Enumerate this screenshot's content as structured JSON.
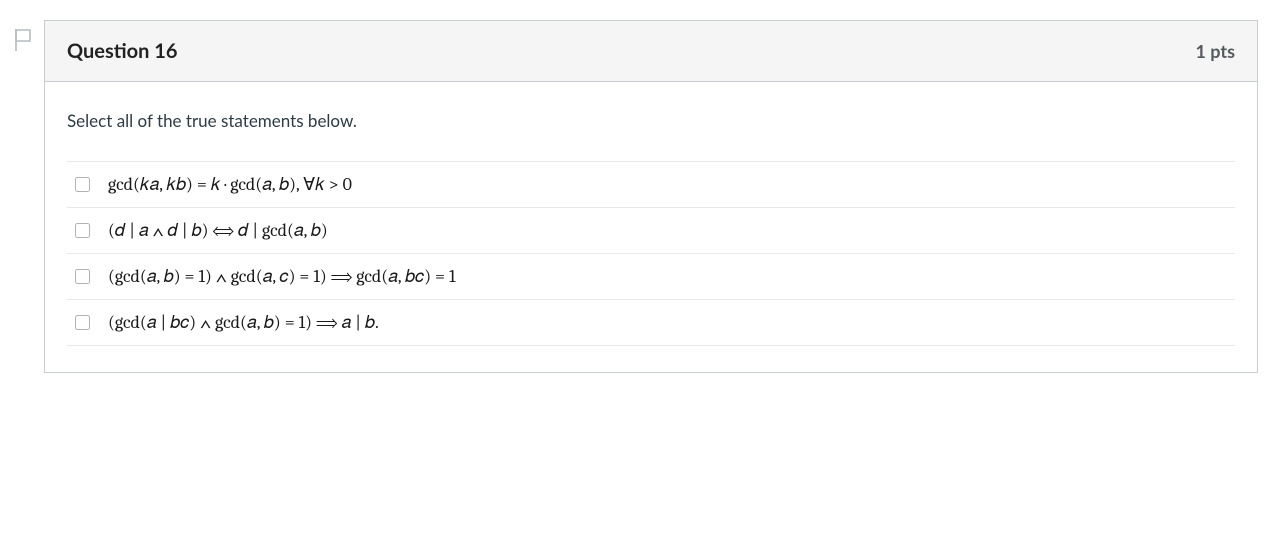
{
  "question": {
    "title": "Question 16",
    "points": "1 pts",
    "prompt": "Select all of the true statements below.",
    "answers": [
      {
        "math": "gcd(𝑘𝑎, 𝑘𝑏) = 𝑘 · gcd(𝑎, 𝑏), ∀𝑘 > 0"
      },
      {
        "math": "(𝑑 | 𝑎 ∧ 𝑑 | 𝑏)  ⟺  𝑑 | gcd(𝑎, 𝑏)"
      },
      {
        "math": "(gcd(𝑎, 𝑏) = 1) ∧ gcd(𝑎, 𝑐) = 1)  ⟹  gcd(𝑎, 𝑏𝑐) = 1"
      },
      {
        "math": "(gcd(𝑎 | 𝑏𝑐) ∧ gcd(𝑎, 𝑏) = 1)  ⟹  𝑎 | 𝑏."
      }
    ]
  },
  "icon": {
    "flag": "flag"
  }
}
